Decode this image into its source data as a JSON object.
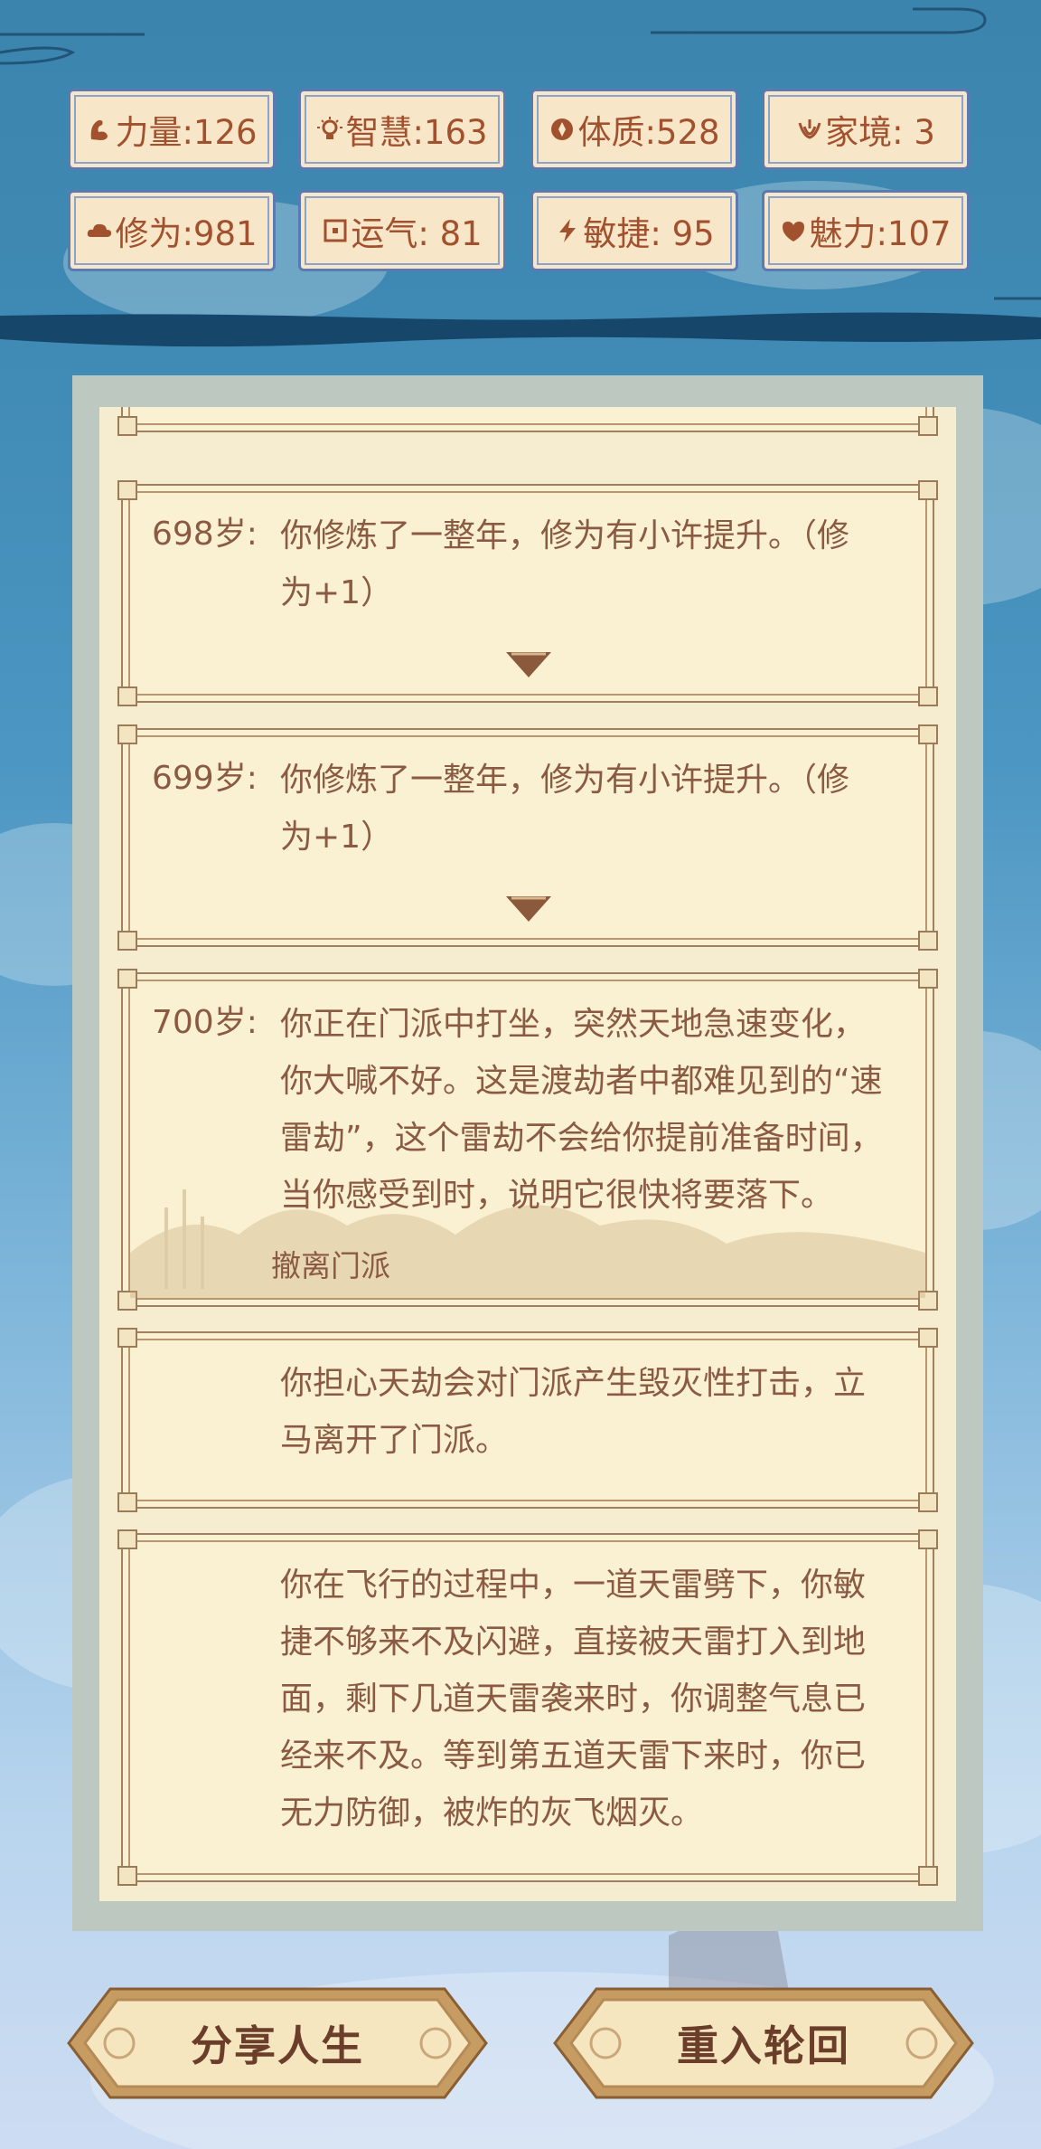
{
  "stats": [
    {
      "icon": "strength-icon",
      "text": "力量:126"
    },
    {
      "icon": "lightbulb-icon",
      "text": "智慧:163"
    },
    {
      "icon": "constitution-icon",
      "text": "体质:528"
    },
    {
      "icon": "family-icon",
      "text": "家境: 3"
    },
    {
      "icon": "cloud-icon",
      "text": "修为:981"
    },
    {
      "icon": "luck-icon",
      "text": "运气: 81"
    },
    {
      "icon": "lightning-icon",
      "text": "敏捷: 95"
    },
    {
      "icon": "charm-icon",
      "text": "魅力:107"
    }
  ],
  "events": [
    {
      "age": "698岁:",
      "line1": "你修炼了一整年，修为有小许提升。（修",
      "line2": "为+1）"
    },
    {
      "age": "699岁:",
      "line1": "你修炼了一整年，修为有小许提升。（修",
      "line2": "为+1）"
    },
    {
      "age": "700岁:",
      "lines": [
        "你正在门派中打坐，突然天地急速变化，",
        "你大喊不好。这是渡劫者中都难见到的“速",
        "雷劫”，这个雷劫不会给你提前准备时间，",
        "当你感受到时，说明它很快将要落下。"
      ],
      "choice": "撤离门派"
    },
    {
      "lines": [
        "你担心天劫会对门派产生毁灭性打击，立",
        "马离开了门派。"
      ]
    },
    {
      "lines": [
        "你在飞行的过程中，一道天雷劈下，你敏",
        "捷不够来不及闪避，直接被天雷打入到地",
        "面，剩下几道天雷袭来时，你调整气息已",
        "经来不及。等到第五道天雷下来时，你已",
        "无力防御，被炸的灰飞烟灭。"
      ]
    }
  ],
  "buttons": {
    "share": "分享人生",
    "rebirth": "重入轮回"
  },
  "colors": {
    "stat_text": "#a2512f",
    "stat_border": "#5b79b2",
    "card_text": "#8b5a43",
    "paper": "#faf1d3"
  }
}
